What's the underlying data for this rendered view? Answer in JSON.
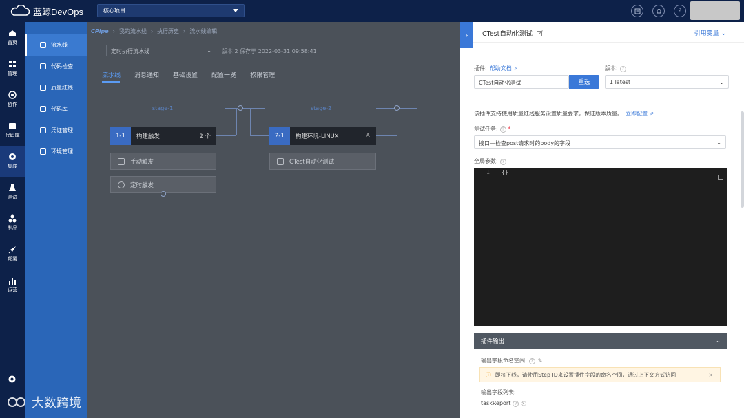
{
  "topbar": {
    "brand": "蓝鲸DevOps",
    "project": "核心项目",
    "icons": [
      "doc-icon",
      "bell-icon",
      "help-icon"
    ]
  },
  "nav1": {
    "items": [
      {
        "label": "首页",
        "icon": "home-icon"
      },
      {
        "label": "管理",
        "icon": "grid-icon"
      },
      {
        "label": "协作",
        "icon": "collab-icon"
      },
      {
        "label": "代码库",
        "icon": "code-icon"
      },
      {
        "label": "集成",
        "icon": "integration-icon",
        "active": true
      },
      {
        "label": "测试",
        "icon": "flask-icon"
      },
      {
        "label": "制品",
        "icon": "artifact-icon"
      },
      {
        "label": "部署",
        "icon": "rocket-icon"
      },
      {
        "label": "运营",
        "icon": "chart-icon"
      }
    ]
  },
  "nav2": {
    "items": [
      {
        "label": "流水线",
        "active": true
      },
      {
        "label": "代码检查"
      },
      {
        "label": "质量红线"
      },
      {
        "label": "代码库"
      },
      {
        "label": "凭证管理"
      },
      {
        "label": "环境管理"
      }
    ]
  },
  "main": {
    "breadcrumb": [
      "CPipe",
      "我的流水线",
      "执行历史",
      "流水线编辑"
    ],
    "pipeline_select": "定时执行流水线",
    "version_info": "版本 2 保存于 2022-03-31 09:58:41",
    "tabs": [
      "流水线",
      "消息通知",
      "基础设置",
      "配置一览",
      "权限管理"
    ],
    "stage1": {
      "label": "stage-1",
      "job_num": "1-1",
      "job_name": "构建触发",
      "job_count": "2 个",
      "tasks": [
        "手动触发",
        "定时触发"
      ]
    },
    "stage2": {
      "label": "stage-2",
      "job_num": "2-1",
      "job_name": "构建环境-LINUX",
      "tasks": [
        "CTest自动化测试"
      ]
    }
  },
  "panel": {
    "title": "CTest自动化测试",
    "ref_var": "引用变量",
    "plugin_label": "插件:",
    "help_doc": "帮助文档",
    "plugin_value": "CTest自动化测试",
    "reselect": "重选",
    "version_label": "版本:",
    "version_value": "1.latest",
    "desc": "该插件支持使用质量红线服务设置质量要求，保证版本质量。",
    "config_now": "立即配置",
    "task_label": "测试任务:",
    "task_value": "接口—检查post请求时的body的字段",
    "global_label": "全局参数:",
    "editor_line": "1",
    "editor_code": "{}",
    "output_head": "插件输出",
    "ns_label": "输出字段命名空间:",
    "warning": "即将下线，请使用Step ID来设置插件字段的命名空间，通过上下文方式访问",
    "list_label": "输出字段列表:",
    "task_report": "taskReport"
  },
  "footer": {
    "watermark": "大数跨境"
  },
  "colors": {
    "topbar": "#0d2149",
    "nav2": "#2a66b8",
    "accent": "#3a78d8",
    "canvas": "#4b5159"
  }
}
